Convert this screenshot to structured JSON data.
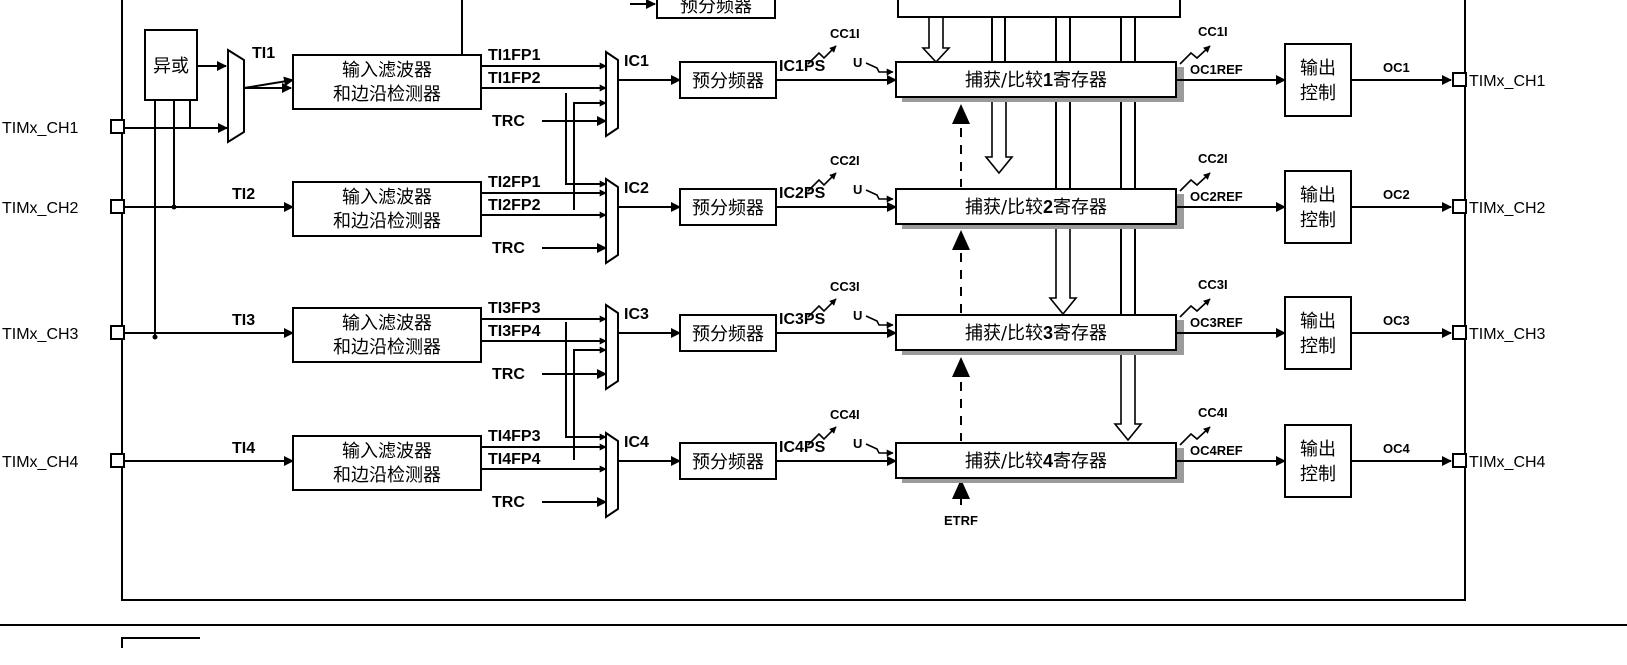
{
  "xor": "异或",
  "filter_line1": "输入滤波器",
  "filter_line2": "和边沿检测器",
  "prescaler": "预分频器",
  "output_ctrl_line1": "输出",
  "output_ctrl_line2": "控制",
  "trc": "TRC",
  "u": "U",
  "etrf": "ETRF",
  "channels": [
    {
      "pin": "TIMx_CH1",
      "ti": "TI1",
      "fp_a": "TI1FP1",
      "fp_b": "TI1FP2",
      "ic": "IC1",
      "icps": "IC1PS",
      "cci": "CC1I",
      "ccr_pre": "捕获/比较",
      "ccr_num": "1",
      "ccr_post": "寄存器",
      "ocref": "OC1REF",
      "oc": "OC1",
      "out_pin": "TIMx_CH1"
    },
    {
      "pin": "TIMx_CH2",
      "ti": "TI2",
      "fp_a": "TI2FP1",
      "fp_b": "TI2FP2",
      "ic": "IC2",
      "icps": "IC2PS",
      "cci": "CC2I",
      "ccr_pre": "捕获/比较",
      "ccr_num": "2",
      "ccr_post": "寄存器",
      "ocref": "OC2REF",
      "oc": "OC2",
      "out_pin": "TIMx_CH2"
    },
    {
      "pin": "TIMx_CH3",
      "ti": "TI3",
      "fp_a": "TI3FP3",
      "fp_b": "TI3FP4",
      "ic": "IC3",
      "icps": "IC3PS",
      "cci": "CC3I",
      "ccr_pre": "捕获/比较",
      "ccr_num": "3",
      "ccr_post": "寄存器",
      "ocref": "OC3REF",
      "oc": "OC3",
      "out_pin": "TIMx_CH3"
    },
    {
      "pin": "TIMx_CH4",
      "ti": "TI4",
      "fp_a": "TI4FP3",
      "fp_b": "TI4FP4",
      "ic": "IC4",
      "icps": "IC4PS",
      "cci": "CC4I",
      "ccr_pre": "捕获/比较",
      "ccr_num": "4",
      "ccr_post": "寄存器",
      "ocref": "OC4REF",
      "oc": "OC4",
      "out_pin": "TIMx_CH4"
    }
  ]
}
